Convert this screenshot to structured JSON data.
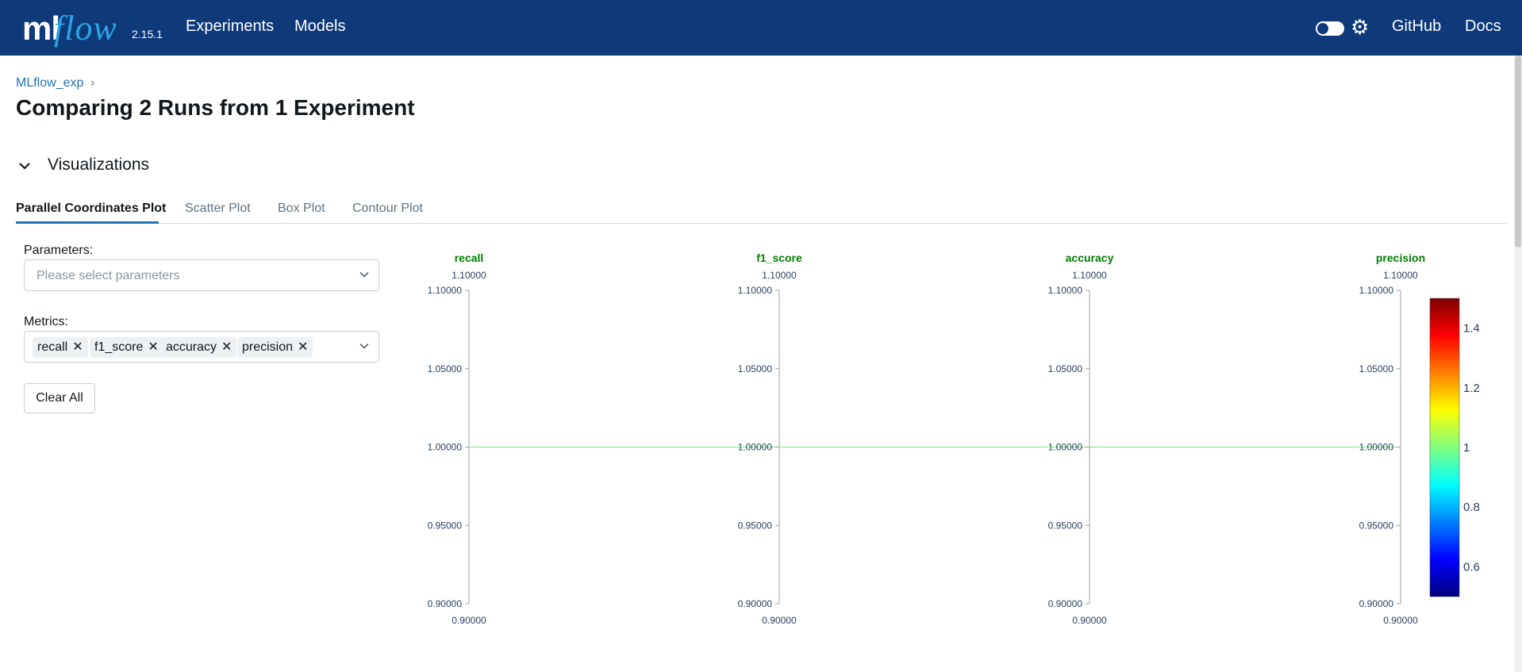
{
  "header": {
    "logo_ml": "ml",
    "logo_flow": "flow",
    "version": "2.15.1",
    "nav": [
      "Experiments",
      "Models"
    ],
    "right_links": [
      "GitHub",
      "Docs"
    ],
    "gear_icon": "gear-icon"
  },
  "breadcrumb": {
    "experiment": "MLflow_exp",
    "separator": "›"
  },
  "page_title": "Comparing 2 Runs from 1 Experiment",
  "section": {
    "chevron_icon": "chevron-down-icon",
    "title": "Visualizations"
  },
  "tabs": [
    {
      "label": "Parallel Coordinates Plot",
      "active": true
    },
    {
      "label": "Scatter Plot",
      "active": false
    },
    {
      "label": "Box Plot",
      "active": false
    },
    {
      "label": "Contour Plot",
      "active": false
    }
  ],
  "parameters": {
    "label": "Parameters:",
    "placeholder": "Please select parameters",
    "chevron": "⌄"
  },
  "metrics": {
    "label": "Metrics:",
    "selected": [
      "recall",
      "f1_score",
      "accuracy",
      "precision"
    ],
    "remove_glyph": "✕",
    "chevron": "⌄"
  },
  "clear_all": "Clear All",
  "chart_data": {
    "type": "parallel_coordinates",
    "accent_color": "#008000",
    "dimensions": [
      {
        "name": "recall",
        "top_label": "1.10000",
        "bottom_label": "0.90000",
        "range": [
          0.9,
          1.1
        ]
      },
      {
        "name": "f1_score",
        "top_label": "1.10000",
        "bottom_label": "0.90000",
        "range": [
          0.9,
          1.1
        ]
      },
      {
        "name": "accuracy",
        "top_label": "1.10000",
        "bottom_label": "0.90000",
        "range": [
          0.9,
          1.1
        ]
      },
      {
        "name": "precision",
        "top_label": "1.10000",
        "bottom_label": "0.90000",
        "range": [
          0.9,
          1.1
        ]
      }
    ],
    "ticks": [
      "1.10000",
      "1.05000",
      "1.00000",
      "0.95000",
      "0.90000"
    ],
    "tick_values": [
      1.1,
      1.05,
      1.0,
      0.95,
      0.9
    ],
    "lines": [
      {
        "values": [
          1.0,
          1.0,
          1.0,
          1.0
        ],
        "color": "#90ee90"
      }
    ],
    "colorbar": {
      "ticks": [
        "1.4",
        "1.2",
        "1",
        "0.8",
        "0.6"
      ],
      "tick_values": [
        1.4,
        1.2,
        1.0,
        0.8,
        0.6
      ],
      "range": [
        0.5,
        1.5
      ],
      "colorscale": "jet"
    }
  }
}
